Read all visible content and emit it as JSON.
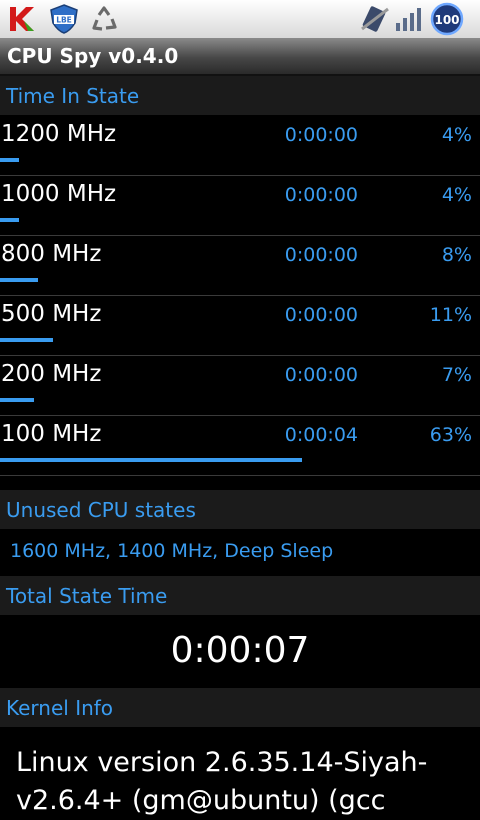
{
  "statusbar": {
    "battery_level": "100",
    "icons": [
      "kaspersky-icon",
      "lbe-icon",
      "recycle-icon",
      "no-sim-icon",
      "signal-icon",
      "battery-icon"
    ]
  },
  "app": {
    "title": "CPU Spy v0.4.0"
  },
  "time_in_state": {
    "header": "Time In State",
    "states": [
      {
        "freq": "1200 MHz",
        "time": "0:00:00",
        "pct": "4%",
        "fraction": 0.04
      },
      {
        "freq": "1000 MHz",
        "time": "0:00:00",
        "pct": "4%",
        "fraction": 0.04
      },
      {
        "freq": "800 MHz",
        "time": "0:00:00",
        "pct": "8%",
        "fraction": 0.08
      },
      {
        "freq": "500 MHz",
        "time": "0:00:00",
        "pct": "11%",
        "fraction": 0.11
      },
      {
        "freq": "200 MHz",
        "time": "0:00:00",
        "pct": "7%",
        "fraction": 0.07
      },
      {
        "freq": "100 MHz",
        "time": "0:00:04",
        "pct": "63%",
        "fraction": 0.63
      }
    ]
  },
  "unused": {
    "header": "Unused CPU states",
    "text": "1600 MHz, 1400 MHz, Deep Sleep"
  },
  "total": {
    "header": "Total State Time",
    "value": "0:00:07"
  },
  "kernel": {
    "header": "Kernel Info",
    "text": "Linux version 2.6.35.14-Siyah-v2.6.4+ (gm@ubuntu) (gcc"
  },
  "colors": {
    "accent": "#3a9cf0"
  }
}
